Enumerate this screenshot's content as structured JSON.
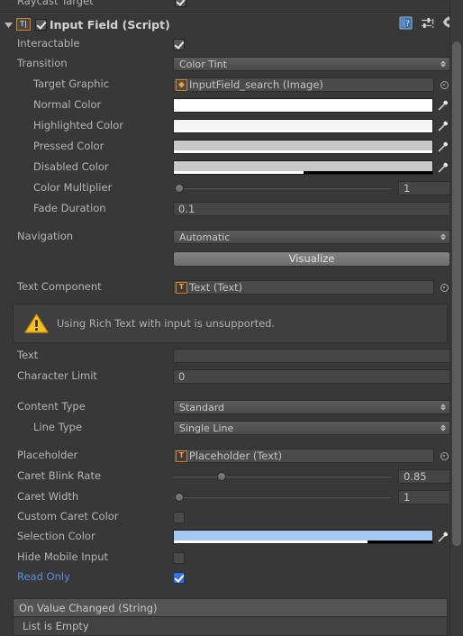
{
  "top_clipped_row": {
    "label": "Raycast Target",
    "checked": true
  },
  "component_header": {
    "title": "Input Field (Script)",
    "enabled_checkbox": true,
    "expanded": true,
    "icon": "inputfield-script-icon",
    "icon_glyph": "T|",
    "header_icons": [
      "help-book-icon",
      "preset-icon",
      "gear-dropdown-icon"
    ],
    "accent_orange": "#d9821e"
  },
  "fields": {
    "interactable": {
      "label": "Interactable",
      "checked": true
    },
    "transition": {
      "label": "Transition",
      "value": "Color Tint"
    },
    "target_graphic": {
      "label": "Target Graphic",
      "value": "InputField_search (Image)",
      "icon": "image-asset-icon"
    },
    "normal_color": {
      "label": "Normal Color",
      "color": "#FFFFFF",
      "alpha_pct": 100
    },
    "highlighted_color": {
      "label": "Highlighted Color",
      "color": "#F5F5F5",
      "alpha_pct": 100
    },
    "pressed_color": {
      "label": "Pressed Color",
      "color": "#C8C8C8",
      "alpha_pct": 100
    },
    "disabled_color": {
      "label": "Disabled Color",
      "color": "#C8C8C8",
      "alpha_pct": 50
    },
    "color_multiplier": {
      "label": "Color Multiplier",
      "value": "1",
      "knob_pct": 1
    },
    "fade_duration": {
      "label": "Fade Duration",
      "value": "0.1"
    },
    "navigation": {
      "label": "Navigation",
      "value": "Automatic"
    },
    "visualize_button": {
      "label": "Visualize"
    },
    "text_component": {
      "label": "Text Component",
      "value": "Text (Text)",
      "icon": "text-asset-icon",
      "icon_glyph": "T"
    },
    "warning": {
      "message": "Using Rich Text with input is unsupported.",
      "icon": "warning-triangle-icon"
    },
    "text": {
      "label": "Text",
      "value": ""
    },
    "character_limit": {
      "label": "Character Limit",
      "value": "0"
    },
    "content_type": {
      "label": "Content Type",
      "value": "Standard"
    },
    "line_type": {
      "label": "Line Type",
      "value": "Single Line"
    },
    "placeholder": {
      "label": "Placeholder",
      "value": "Placeholder (Text)",
      "icon": "text-asset-icon",
      "icon_glyph": "T"
    },
    "caret_blink_rate": {
      "label": "Caret Blink Rate",
      "value": "0.85",
      "knob_pct": 21
    },
    "caret_width": {
      "label": "Caret Width",
      "value": "1",
      "knob_pct": 1
    },
    "custom_caret_color": {
      "label": "Custom Caret Color",
      "checked": false
    },
    "selection_color": {
      "label": "Selection Color",
      "color": "#A5C8F5",
      "alpha_pct": 75
    },
    "hide_mobile_input": {
      "label": "Hide Mobile Input",
      "checked": false
    },
    "read_only": {
      "label": "Read Only",
      "checked": true,
      "overridden": true,
      "label_color": "#5c8fe0"
    }
  },
  "event_list": {
    "header": "On Value Changed (String)",
    "empty_message": "List is Empty"
  }
}
